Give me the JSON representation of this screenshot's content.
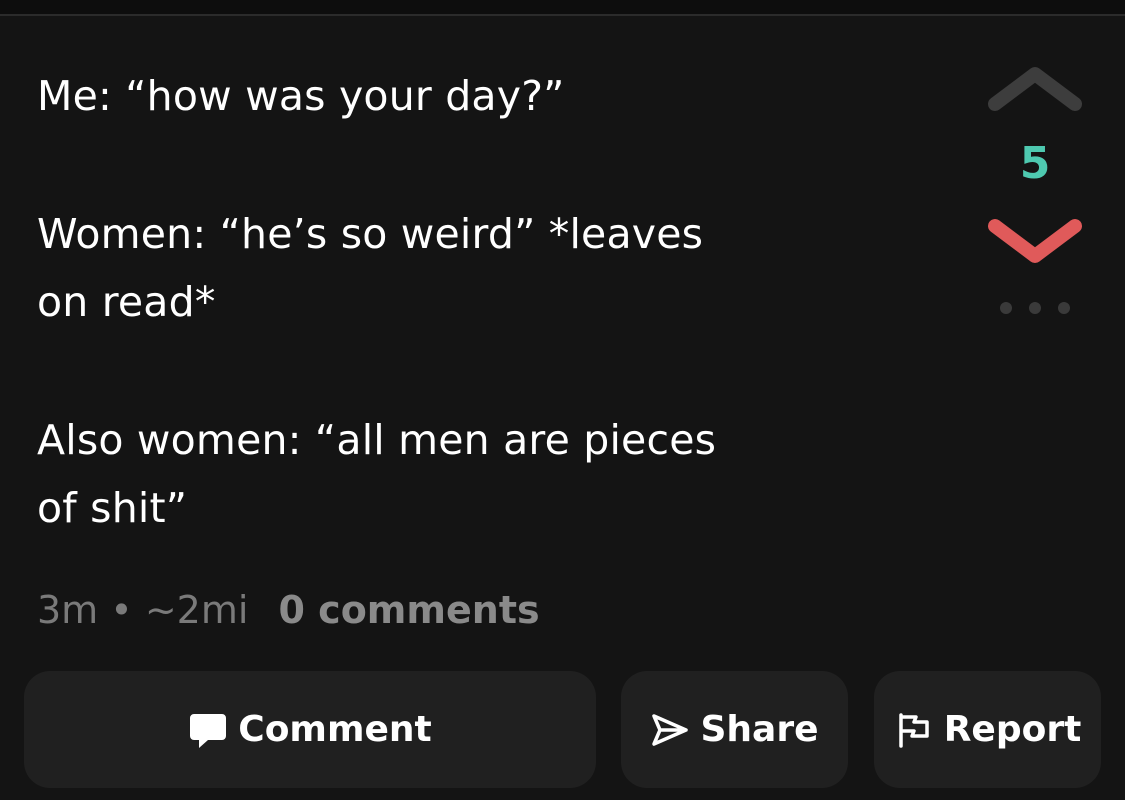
{
  "post": {
    "paragraphs": [
      [
        "Me: “how was your day?”"
      ],
      [
        "Women: “he’s so weird” *leaves",
        "on read*"
      ],
      [
        "Also women: “all men are pieces",
        "of shit”"
      ]
    ]
  },
  "votes": {
    "count": "5",
    "count_color": "#4ec9b0",
    "downvote_color": "#e05a5a",
    "upvote_color": "#3d3d3d"
  },
  "meta": {
    "age": "3m",
    "separator": "•",
    "distance": "~2mi",
    "comments_label": "0 comments"
  },
  "actions": {
    "comment_label": "Comment",
    "share_label": "Share",
    "report_label": "Report"
  },
  "icons": {
    "upvote": "chevron-up-icon",
    "downvote": "chevron-down-icon",
    "more": "more-dots-icon",
    "comment": "speech-bubble-icon",
    "share": "paper-plane-icon",
    "report": "flag-icon"
  }
}
